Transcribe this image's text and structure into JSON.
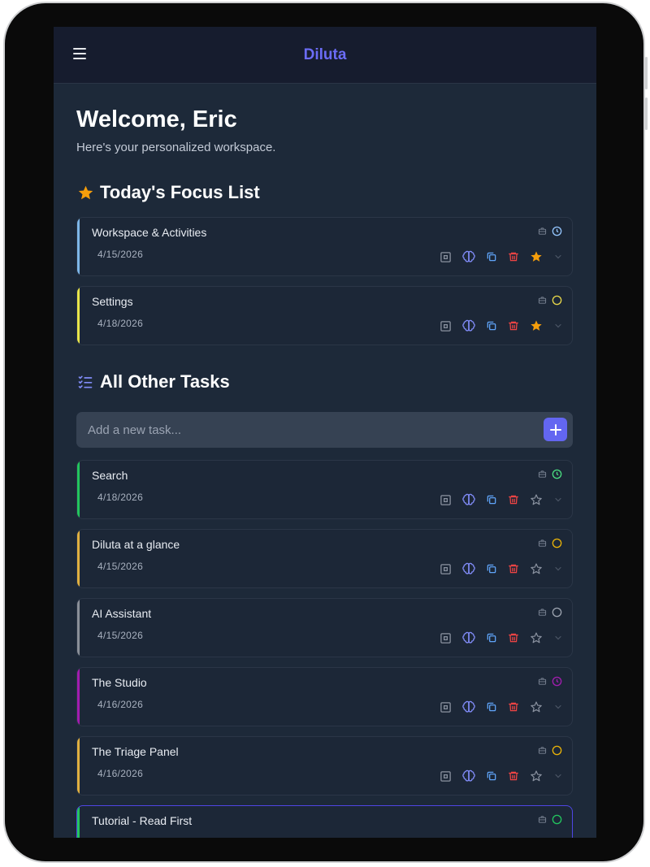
{
  "app": {
    "title": "Diluta"
  },
  "welcome": {
    "heading": "Welcome, Eric",
    "subtitle": "Here's your personalized workspace."
  },
  "focus": {
    "heading": "Today's Focus List",
    "icon": "star-icon",
    "tasks": [
      {
        "title": "Workspace & Activities",
        "date": "4/15/2026",
        "accent": "#7db6e8",
        "status": "clock",
        "status_color": "#93c5fd",
        "starred": true
      },
      {
        "title": "Settings",
        "date": "4/18/2026",
        "accent": "#e8e54a",
        "status": "circle",
        "status_color": "#e8d84a",
        "starred": true
      }
    ]
  },
  "other": {
    "heading": "All Other Tasks",
    "icon": "list-check-icon",
    "add_placeholder": "Add a new task...",
    "tasks": [
      {
        "title": "Search",
        "date": "4/18/2026",
        "accent": "#22c55e",
        "status": "clock",
        "status_color": "#4ade80",
        "starred": false
      },
      {
        "title": "Diluta at a glance",
        "date": "4/15/2026",
        "accent": "#e0b040",
        "status": "circle",
        "status_color": "#eab308",
        "starred": false
      },
      {
        "title": "AI Assistant",
        "date": "4/15/2026",
        "accent": "#8a8f98",
        "status": "circle",
        "status_color": "#9ca3af",
        "starred": false
      },
      {
        "title": "The Studio",
        "date": "4/16/2026",
        "accent": "#a21caf",
        "status": "clock",
        "status_color": "#a21caf",
        "starred": false
      },
      {
        "title": "The Triage Panel",
        "date": "4/16/2026",
        "accent": "#e0b040",
        "status": "circle",
        "status_color": "#eab308",
        "starred": false
      },
      {
        "title": "Tutorial - Read First",
        "date": "",
        "accent": "#22c55e",
        "status": "circle",
        "status_color": "#22c55e",
        "starred": false
      }
    ]
  },
  "colors": {
    "accent": "#6366f1",
    "star": "#f59e0b",
    "brain": "#818cf8",
    "copy": "#60a5fa",
    "delete": "#ef4444"
  }
}
